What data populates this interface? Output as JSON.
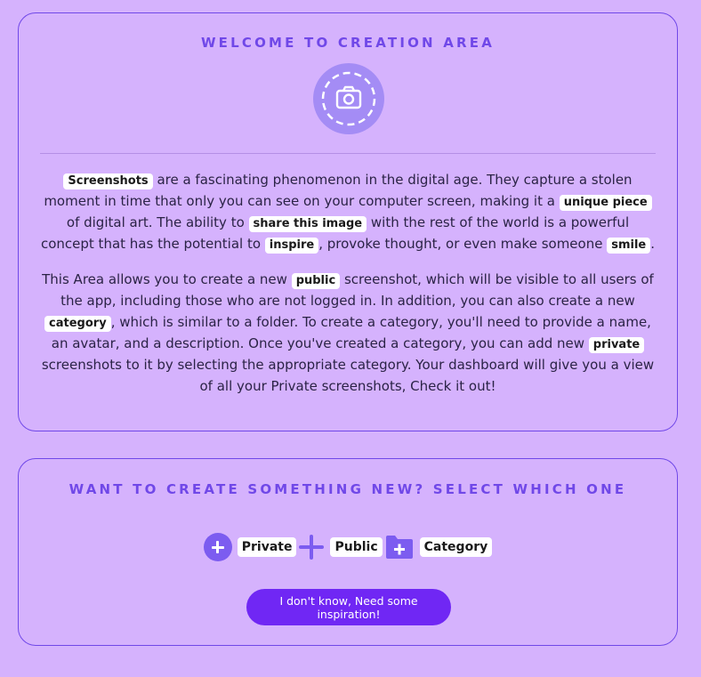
{
  "welcome": {
    "title": "WELCOME TO CREATION AREA",
    "icon": "camera-icon",
    "para1": {
      "chip_screenshots": "Screenshots",
      "t1": " are a fascinating phenomenon in the digital age. They capture a stolen moment in time that only you can see on your computer screen, making it a ",
      "chip_unique": "unique piece",
      "t2": " of digital art. The ability to ",
      "chip_share": "share this image",
      "t3": " with the rest of the world is a powerful concept that has the potential to ",
      "chip_inspire": "inspire",
      "t4": ", provoke thought, or even make someone ",
      "chip_smile": "smile",
      "t5": "."
    },
    "para2": {
      "t1": "This Area allows you to create a new ",
      "chip_public": "public",
      "t2": " screenshot, which will be visible to all users of the app, including those who are not logged in. In addition, you can also create a new ",
      "chip_category": "category",
      "t3": ", which is similar to a folder. To create a category, you'll need to provide a name, an avatar, and a description. Once you've created a category, you can add new ",
      "chip_private": "private",
      "t4": " screenshots to it by selecting the appropriate category. Your dashboard will give you a view of all your Private screenshots, Check it out!"
    }
  },
  "create": {
    "title": "WANT TO CREATE SOMETHING NEW? SELECT WHICH ONE",
    "options": [
      {
        "label": "Private",
        "icon": "plus-circle-icon"
      },
      {
        "label": "Public",
        "icon": "plus-icon"
      },
      {
        "label": "Category",
        "icon": "folder-plus-icon"
      }
    ],
    "inspiration_button": "I don't know, Need some inspiration!"
  },
  "colors": {
    "background": "#d5b2fd",
    "accent": "#7048e8",
    "button": "#7027f4",
    "icon": "#7c5cf0"
  }
}
